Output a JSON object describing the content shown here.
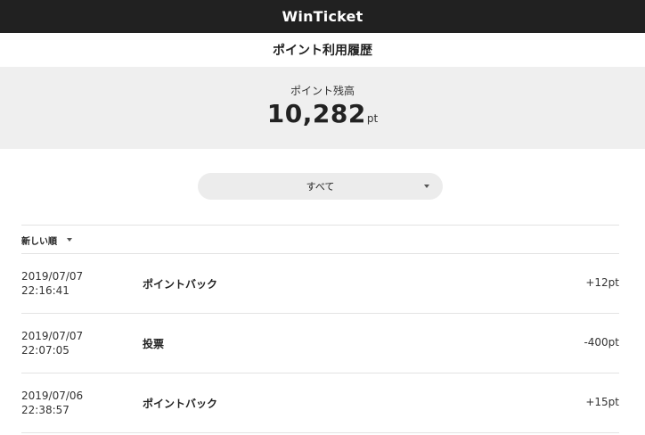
{
  "header": {
    "app_title": "WinTicket"
  },
  "page": {
    "title": "ポイント利用履歴"
  },
  "balance": {
    "label": "ポイント残高",
    "value": "10,282",
    "unit": "pt"
  },
  "filter": {
    "selected": "すべて"
  },
  "sort": {
    "selected": "新しい順"
  },
  "history": [
    {
      "date": "2019/07/07",
      "time": "22:16:41",
      "description": "ポイントバック",
      "amount": "+12pt"
    },
    {
      "date": "2019/07/07",
      "time": "22:07:05",
      "description": "投票",
      "amount": "-400pt"
    },
    {
      "date": "2019/07/06",
      "time": "22:38:57",
      "description": "ポイントバック",
      "amount": "+15pt"
    }
  ]
}
